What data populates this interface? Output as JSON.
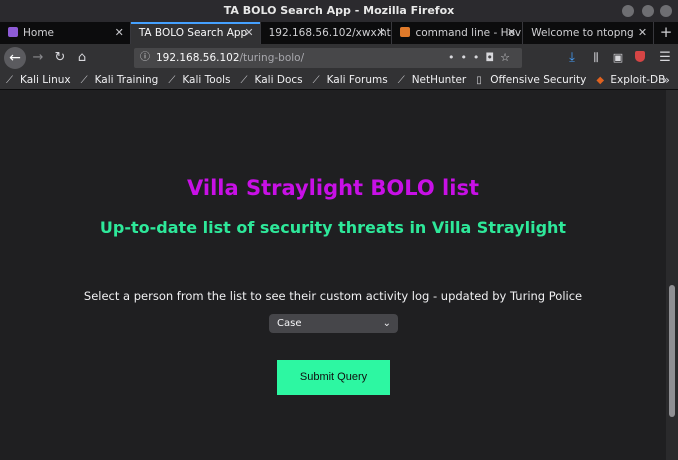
{
  "window": {
    "title": "TA BOLO Search App - Mozilla Firefox"
  },
  "tabs": [
    {
      "label": "Home",
      "active": false
    },
    {
      "label": "TA BOLO Search App",
      "active": true
    },
    {
      "label": "192.168.56.102/xwx.ht",
      "active": false
    },
    {
      "label": "command line - Hov",
      "active": false
    },
    {
      "label": "Welcome to ntopng",
      "active": false
    }
  ],
  "navbar": {
    "url_host": "192.168.56.102",
    "url_path": "/turing-bolo/"
  },
  "bookmarks": [
    {
      "label": "Kali Linux",
      "icon": "kali-dragon-icon"
    },
    {
      "label": "Kali Training",
      "icon": "kali-dragon-icon"
    },
    {
      "label": "Kali Tools",
      "icon": "kali-dragon-icon"
    },
    {
      "label": "Kali Docs",
      "icon": "kali-dragon-icon"
    },
    {
      "label": "Kali Forums",
      "icon": "kali-dragon-icon"
    },
    {
      "label": "NetHunter",
      "icon": "kali-dragon-icon"
    },
    {
      "label": "Offensive Security",
      "icon": "offsec-icon"
    },
    {
      "label": "Exploit-DB",
      "icon": "exploitdb-icon"
    }
  ],
  "page": {
    "title": "Villa Straylight BOLO list",
    "subtitle": "Up-to-date list of security threats in Villa Straylight",
    "instruction": "Select a person from the list to see their custom activity log - updated by Turing Police",
    "select_value": "Case",
    "submit_label": "Submit Query"
  },
  "colors": {
    "title": "#c810e6",
    "subtitle": "#2ee89a",
    "button": "#2df7a2",
    "background": "#1f1f21"
  }
}
